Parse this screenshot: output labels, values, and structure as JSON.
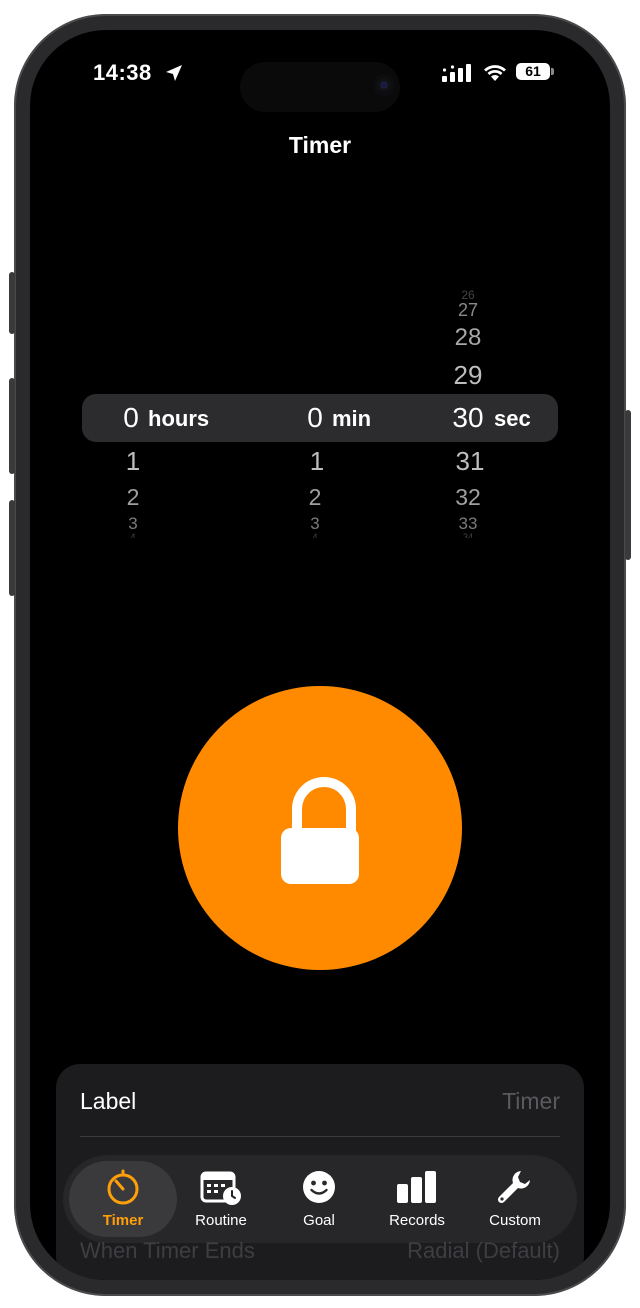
{
  "status_bar": {
    "time": "14:38",
    "battery": "61"
  },
  "header": {
    "title": "Timer"
  },
  "picker": {
    "hours": {
      "above": [
        "",
        ""
      ],
      "selected": "0",
      "unit": "hours",
      "below": [
        "1",
        "2",
        "3",
        "4"
      ]
    },
    "minutes": {
      "above": [
        "",
        ""
      ],
      "selected": "0",
      "unit": "min",
      "below": [
        "1",
        "2",
        "3",
        "4"
      ]
    },
    "seconds": {
      "above": [
        "26",
        "27",
        "28",
        "29"
      ],
      "selected": "30",
      "unit": "sec",
      "below": [
        "31",
        "32",
        "33",
        "34"
      ]
    }
  },
  "lock_button": {
    "icon": "lock-icon",
    "color": "#ff8a00"
  },
  "settings": {
    "label_title": "Label",
    "label_value": "Timer",
    "when_ends_title": "When Timer Ends",
    "when_ends_value": "Radial (Default)"
  },
  "tabbar": {
    "active_color": "#ff9f0a",
    "tabs": [
      {
        "label": "Timer",
        "icon": "stopwatch-icon",
        "active": true
      },
      {
        "label": "Routine",
        "icon": "calendar-clock-icon",
        "active": false
      },
      {
        "label": "Goal",
        "icon": "smiley-icon",
        "active": false
      },
      {
        "label": "Records",
        "icon": "bar-chart-icon",
        "active": false
      },
      {
        "label": "Custom",
        "icon": "wrench-icon",
        "active": false
      }
    ]
  }
}
